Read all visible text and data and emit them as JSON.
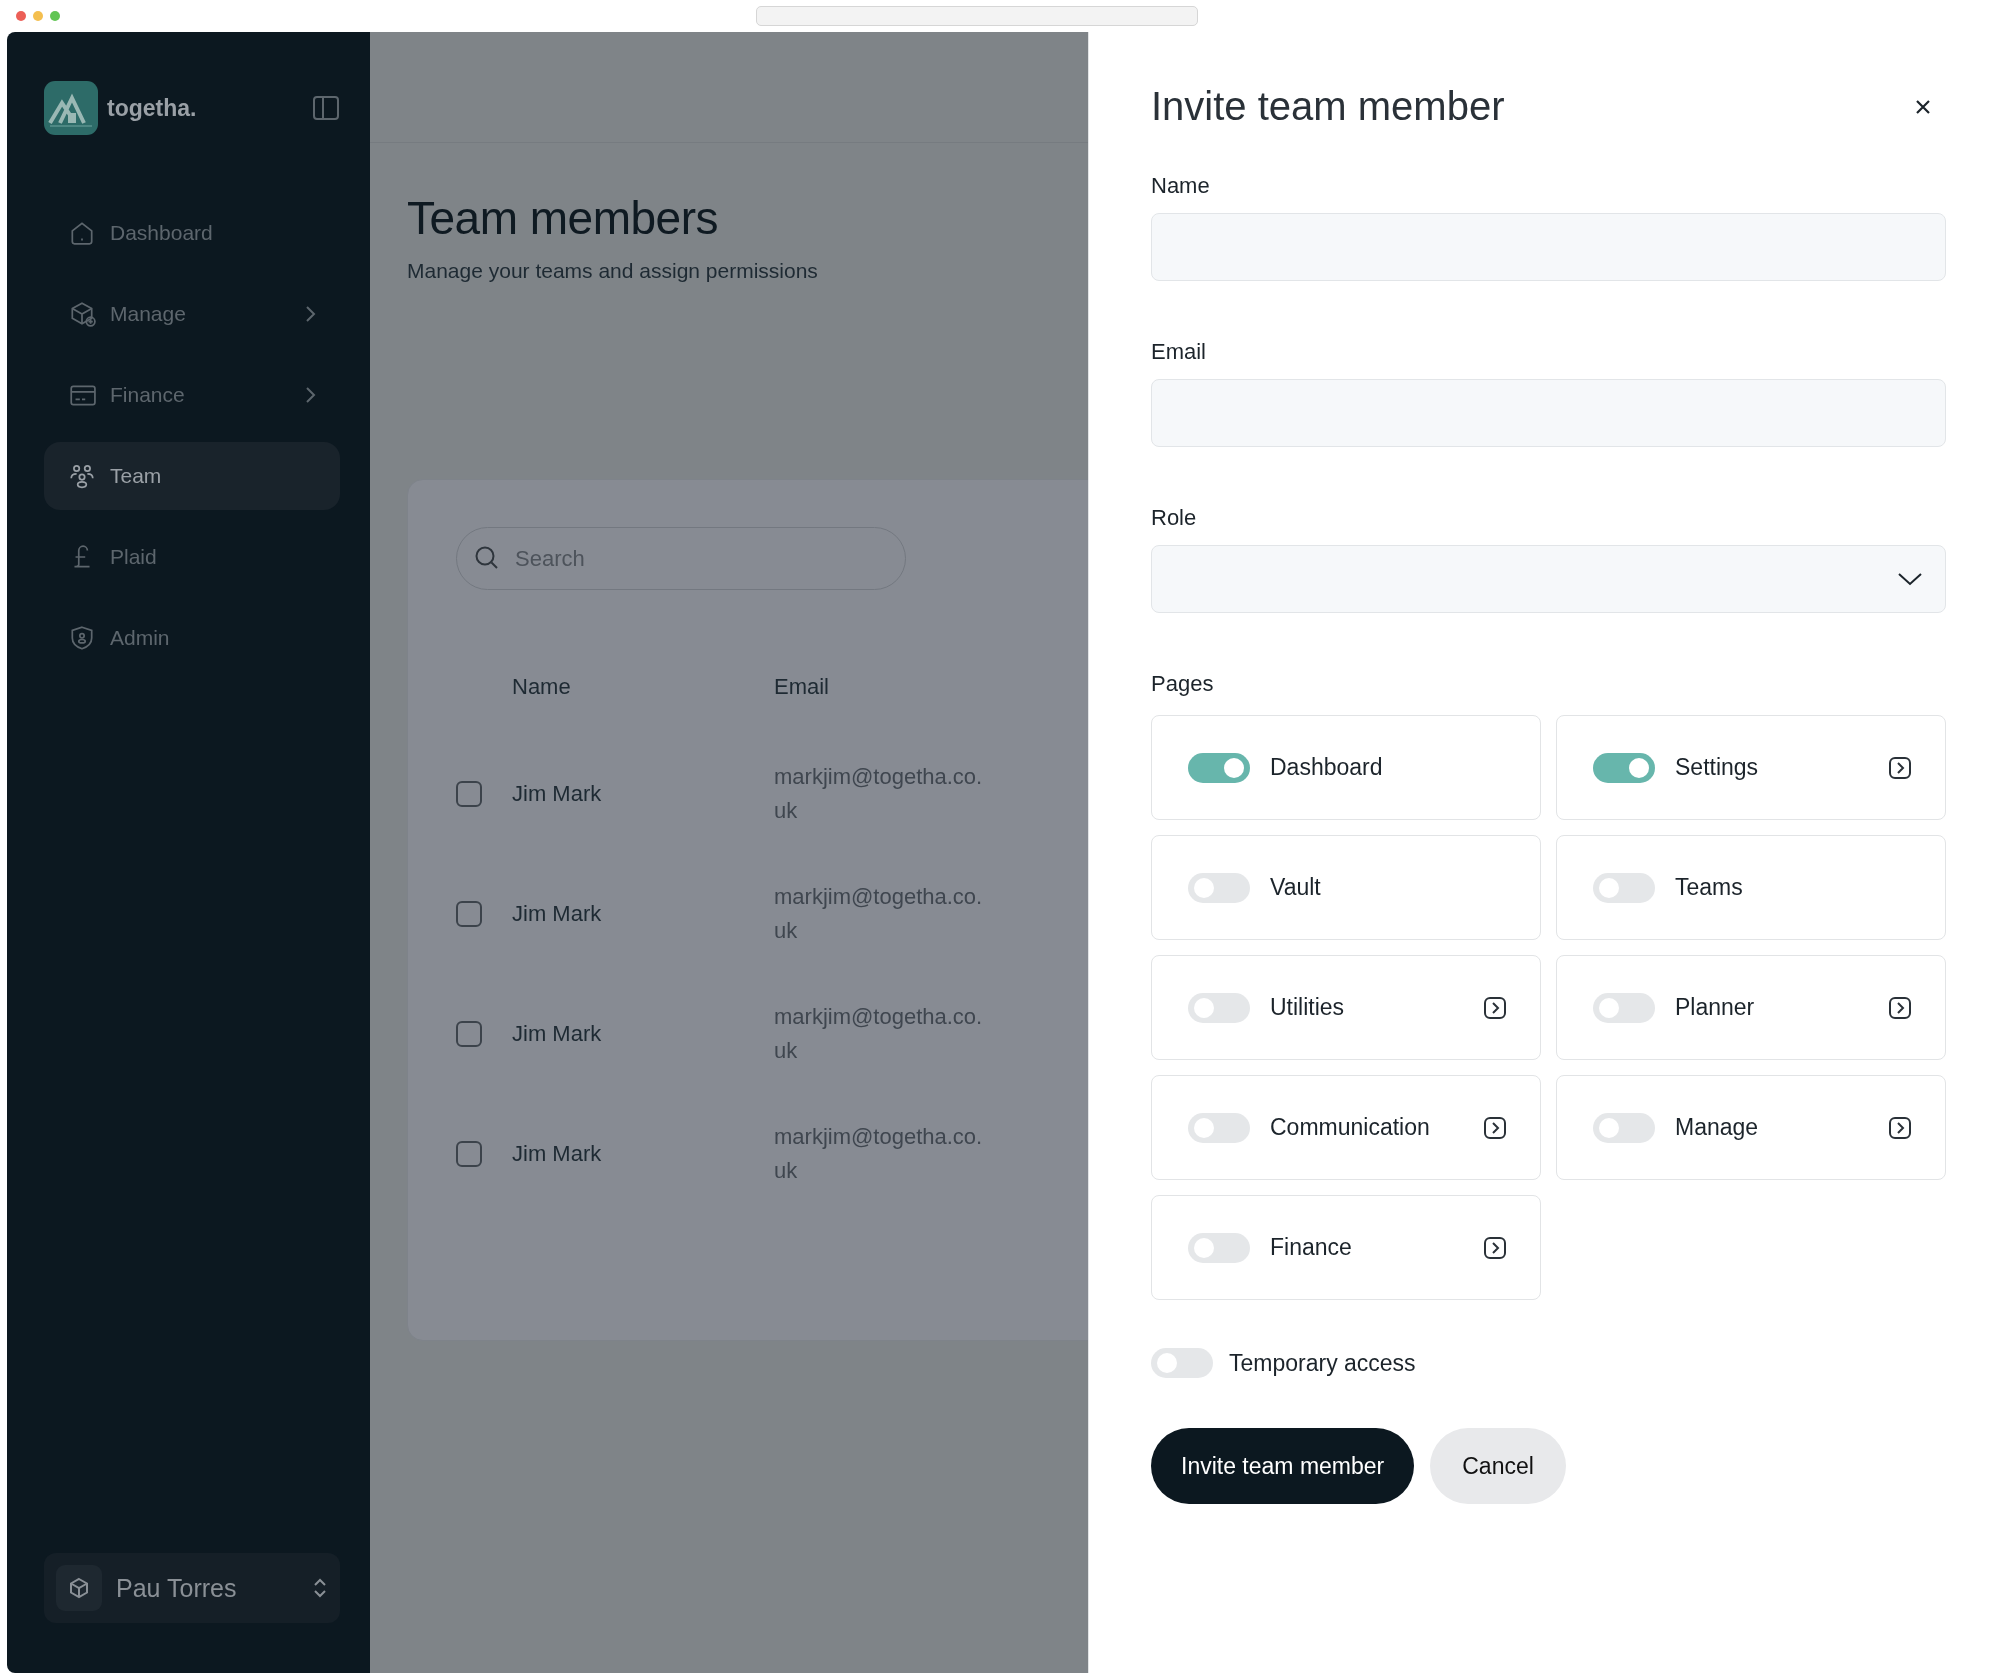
{
  "sidebar": {
    "logo_text": "togetha.",
    "items": [
      {
        "label": "Dashboard",
        "selected": false,
        "expandable": false
      },
      {
        "label": "Manage",
        "selected": false,
        "expandable": true
      },
      {
        "label": "Finance",
        "selected": false,
        "expandable": true
      },
      {
        "label": "Team",
        "selected": true,
        "expandable": false
      },
      {
        "label": "Plaid",
        "selected": false,
        "expandable": false
      },
      {
        "label": "Admin",
        "selected": false,
        "expandable": false
      }
    ],
    "user": {
      "name": "Pau Torres"
    }
  },
  "page": {
    "title": "Team members",
    "subtitle": "Manage your teams and assign permissions",
    "search": {
      "placeholder": "Search"
    },
    "table": {
      "columns": [
        "Name",
        "Email"
      ],
      "rows": [
        {
          "checked": false,
          "name": "Jim Mark",
          "email": "markjim@togetha.co.uk"
        },
        {
          "checked": false,
          "name": "Jim Mark",
          "email": "markjim@togetha.co.uk"
        },
        {
          "checked": false,
          "name": "Jim Mark",
          "email": "markjim@togetha.co.uk"
        },
        {
          "checked": false,
          "name": "Jim Mark",
          "email": "markjim@togetha.co.uk"
        }
      ]
    }
  },
  "dialog": {
    "title": "Invite team member",
    "fields": [
      {
        "kind": "text",
        "label": "Name"
      },
      {
        "kind": "text",
        "label": "Email"
      },
      {
        "kind": "select",
        "label": "Role"
      }
    ],
    "pages_label": "Pages",
    "pages": [
      {
        "label": "Dashboard",
        "on": true,
        "has_link": false
      },
      {
        "label": "Settings",
        "on": true,
        "has_link": true
      },
      {
        "label": "Vault",
        "on": false,
        "has_link": false
      },
      {
        "label": "Teams",
        "on": false,
        "has_link": false
      },
      {
        "label": "Utilities",
        "on": false,
        "has_link": true
      },
      {
        "label": "Planner",
        "on": false,
        "has_link": true
      },
      {
        "label": "Communication",
        "on": false,
        "has_link": true
      },
      {
        "label": "Manage",
        "on": false,
        "has_link": true
      },
      {
        "label": "Finance",
        "on": false,
        "has_link": true
      }
    ],
    "temporary_access": {
      "label": "Temporary access",
      "on": false
    },
    "buttons": [
      {
        "kind": "primary",
        "label": "Invite team member"
      },
      {
        "kind": "secondary",
        "label": "Cancel"
      }
    ]
  }
}
